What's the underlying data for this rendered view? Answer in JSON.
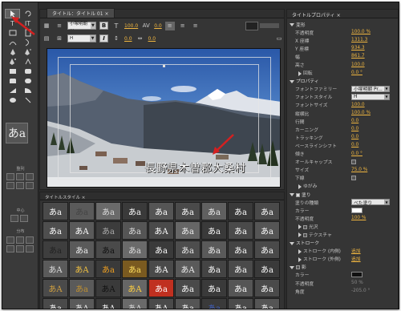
{
  "title_panel": {
    "tab_label": "タイトル：タイトル 01",
    "font_family_value": "小塚明朝 ...",
    "font_style_value": "H",
    "bold_label": "B",
    "italic_label": "I",
    "size_value": "100.0",
    "kerning_value": "0.0",
    "tracking_value": "0.0",
    "leading_value": "0.0"
  },
  "preview": {
    "title_text": "長野県木曽郡大桑村"
  },
  "tools_panel": {
    "align_label": "整列",
    "center_label": "中心",
    "distribute_label": "分布",
    "style_sample": "あa"
  },
  "styles_panel": {
    "tab_label": "タイトルスタイル",
    "swatches": [
      {
        "t": "あa",
        "bg": "#4a4a4a",
        "fg": "#ffffff"
      },
      {
        "t": "あa",
        "bg": "#5a5a5a",
        "fg": "#444444"
      },
      {
        "t": "あa",
        "bg": "#6a6a6a",
        "fg": "#dddddd"
      },
      {
        "t": "あa",
        "bg": "#3a3a3a",
        "fg": "#ffffff"
      },
      {
        "t": "あa",
        "bg": "#555555",
        "fg": "#ffffff"
      },
      {
        "t": "あa",
        "bg": "#4a4a4a",
        "fg": "#ffffff"
      },
      {
        "t": "あa",
        "bg": "#606060",
        "fg": "#eeeeee"
      },
      {
        "t": "あa",
        "bg": "#3a3a3a",
        "fg": "#ffffff"
      },
      {
        "t": "あa",
        "bg": "#4a4a4a",
        "fg": "#ffffff"
      },
      {
        "t": "あa",
        "bg": "#4e4e4e",
        "fg": "#ffffff"
      },
      {
        "t": "あA",
        "bg": "#5a5a5a",
        "fg": "#ffffff"
      },
      {
        "t": "あa",
        "bg": "#3c3c3c",
        "fg": "#aaaaaa"
      },
      {
        "t": "あa",
        "bg": "#555555",
        "fg": "#dddddd"
      },
      {
        "t": "あA",
        "bg": "#4a4a4a",
        "fg": "#ffffff"
      },
      {
        "t": "あa",
        "bg": "#666666",
        "fg": "#f0f0f0"
      },
      {
        "t": "あa",
        "bg": "#3a3a3a",
        "fg": "#ffffff"
      },
      {
        "t": "あa",
        "bg": "#4a4a4a",
        "fg": "#ffffff"
      },
      {
        "t": "あa",
        "bg": "#555555",
        "fg": "#ffffff"
      },
      {
        "t": "あa",
        "bg": "#3e3e3e",
        "fg": "#222222"
      },
      {
        "t": "あa",
        "bg": "#5a5a5a",
        "fg": "#eeeeee"
      },
      {
        "t": "あa",
        "bg": "#4a4a4a",
        "fg": "#111111"
      },
      {
        "t": "あa",
        "bg": "#6a6a6a",
        "fg": "#dddddd"
      },
      {
        "t": "あa",
        "bg": "#3a3a3a",
        "fg": "#ffffff"
      },
      {
        "t": "あa",
        "bg": "#4d4d4d",
        "fg": "#eeeeee"
      },
      {
        "t": "あa",
        "bg": "#5a5a5a",
        "fg": "#eeeeee"
      },
      {
        "t": "あa",
        "bg": "#444444",
        "fg": "#ffffff"
      },
      {
        "t": "あa",
        "bg": "#4a4a4a",
        "fg": "#ffffff"
      },
      {
        "t": "あA",
        "bg": "#5a5a5a",
        "fg": "#dddddd"
      },
      {
        "t": "あA",
        "bg": "#4a4a4a",
        "fg": "#f0c040"
      },
      {
        "t": "あa",
        "bg": "#3a3a3a",
        "fg": "#f0a020"
      },
      {
        "t": "あa",
        "bg": "#7a5a20",
        "fg": "#ffe060"
      },
      {
        "t": "あA",
        "bg": "#4a4a4a",
        "fg": "#ffffff"
      },
      {
        "t": "あA",
        "bg": "#5a5a5a",
        "fg": "#eeeeee"
      },
      {
        "t": "あa",
        "bg": "#444444",
        "fg": "#ffffff"
      },
      {
        "t": "あa",
        "bg": "#4a4a4a",
        "fg": "#ffffff"
      },
      {
        "t": "あa",
        "bg": "#3a3a3a",
        "fg": "#ffffff"
      },
      {
        "t": "あA",
        "bg": "#4a4a4a",
        "fg": "#d0a040"
      },
      {
        "t": "あa",
        "bg": "#5a5a5a",
        "fg": "#c09030"
      },
      {
        "t": "あA",
        "bg": "#3a3a3a",
        "fg": "#111111"
      },
      {
        "t": "あA",
        "bg": "#666666",
        "fg": "#ffd040"
      },
      {
        "t": "あa",
        "bg": "#c03020",
        "fg": "#ffffff"
      },
      {
        "t": "あa",
        "bg": "#4a4a4a",
        "fg": "#ffffff"
      },
      {
        "t": "あa",
        "bg": "#3a3a3a",
        "fg": "#ffffff"
      },
      {
        "t": "あa",
        "bg": "#555555",
        "fg": "#ffffff"
      },
      {
        "t": "あa",
        "bg": "#4a4a4a",
        "fg": "#ffffff"
      },
      {
        "t": "あa",
        "bg": "#4a4a4a",
        "fg": "#ffffff"
      },
      {
        "t": "あA",
        "bg": "#5a5a5a",
        "fg": "#eeeeee"
      },
      {
        "t": "あA",
        "bg": "#3a3a3a",
        "fg": "#ffffff"
      },
      {
        "t": "あA",
        "bg": "#6a6a6a",
        "fg": "#dddddd"
      },
      {
        "t": "あA",
        "bg": "#4a4a4a",
        "fg": "#ffffff"
      },
      {
        "t": "あa",
        "bg": "#555555",
        "fg": "#ffffff"
      },
      {
        "t": "あa",
        "bg": "#3a3a3a",
        "fg": "#4060c0"
      },
      {
        "t": "あa",
        "bg": "#4a4a4a",
        "fg": "#ffffff"
      },
      {
        "t": "あa",
        "bg": "#555555",
        "fg": "#ffffff"
      }
    ]
  },
  "props_panel": {
    "tab_label": "タイトルプロパティ",
    "rows": [
      {
        "kind": "section",
        "label": "変形"
      },
      {
        "kind": "row",
        "label": "不透明度",
        "value": "100.0 %",
        "vtype": "num"
      },
      {
        "kind": "row",
        "label": "X 座標",
        "value": "1311.3",
        "vtype": "num"
      },
      {
        "kind": "row",
        "label": "Y 座標",
        "value": "934.3",
        "vtype": "num"
      },
      {
        "kind": "row",
        "label": "幅",
        "value": "861.7",
        "vtype": "num"
      },
      {
        "kind": "row",
        "label": "高さ",
        "value": "100.0",
        "vtype": "num"
      },
      {
        "kind": "sub",
        "label": "回転",
        "value": "0.0 °",
        "vtype": "num"
      },
      {
        "kind": "section",
        "label": "プロパティ"
      },
      {
        "kind": "row",
        "label": "フォントファミリー",
        "value": "小塚明朝 Pr...",
        "vtype": "dd"
      },
      {
        "kind": "row",
        "label": "フォントスタイル",
        "value": "H",
        "vtype": "dd"
      },
      {
        "kind": "row",
        "label": "フォントサイズ",
        "value": "100.0",
        "vtype": "num"
      },
      {
        "kind": "row",
        "label": "縦横比",
        "value": "100.0 %",
        "vtype": "num"
      },
      {
        "kind": "row",
        "label": "行間",
        "value": "0.0",
        "vtype": "num"
      },
      {
        "kind": "row",
        "label": "カーニング",
        "value": "0.0",
        "vtype": "num"
      },
      {
        "kind": "row",
        "label": "トラッキング",
        "value": "0.0",
        "vtype": "num"
      },
      {
        "kind": "row",
        "label": "ベースラインシフト",
        "value": "0.0",
        "vtype": "num"
      },
      {
        "kind": "row",
        "label": "傾き",
        "value": "0.0 °",
        "vtype": "num"
      },
      {
        "kind": "row",
        "label": "オールキャップス",
        "value": "",
        "vtype": "check"
      },
      {
        "kind": "row",
        "label": "サイズ",
        "value": "75.0 %",
        "vtype": "num"
      },
      {
        "kind": "row",
        "label": "下線",
        "value": "",
        "vtype": "check"
      },
      {
        "kind": "sub",
        "label": "ゆがみ",
        "value": "",
        "vtype": "none"
      },
      {
        "kind": "sectioncb",
        "label": "塗り",
        "value": "",
        "vtype": "none",
        "on": true
      },
      {
        "kind": "row",
        "label": "塗りの種類",
        "value": "べた塗り",
        "vtype": "dd"
      },
      {
        "kind": "row",
        "label": "カラー",
        "value": "",
        "vtype": "color-white"
      },
      {
        "kind": "row",
        "label": "不透明度",
        "value": "100 %",
        "vtype": "num"
      },
      {
        "kind": "subcb",
        "label": "光沢",
        "value": "",
        "vtype": "none"
      },
      {
        "kind": "subcb",
        "label": "テクスチャ",
        "value": "",
        "vtype": "none"
      },
      {
        "kind": "section",
        "label": "ストローク"
      },
      {
        "kind": "sub",
        "label": "ストローク (内側)",
        "value": "追加",
        "vtype": "link"
      },
      {
        "kind": "sub",
        "label": "ストローク (外側)",
        "value": "追加",
        "vtype": "link"
      },
      {
        "kind": "sectioncb",
        "label": "影",
        "value": "",
        "vtype": "none",
        "on": false
      },
      {
        "kind": "row",
        "label": "カラー",
        "value": "",
        "vtype": "color-black"
      },
      {
        "kind": "row",
        "label": "不透明度",
        "value": "50 %",
        "vtype": "grey"
      },
      {
        "kind": "row",
        "label": "角度",
        "value": "-205.0 °",
        "vtype": "grey"
      }
    ]
  },
  "colors": {
    "accent_orange": "#f0b640",
    "annotation_red": "#d42020",
    "panel_bg": "#353535"
  }
}
